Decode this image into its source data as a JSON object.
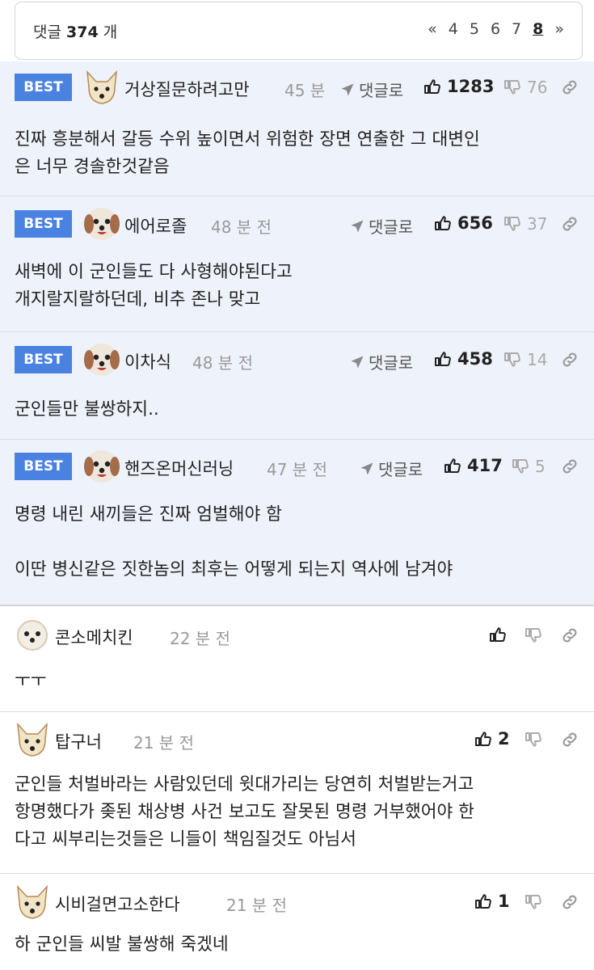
{
  "header": {
    "count_prefix": "댓글",
    "count": "374",
    "count_suffix": "개",
    "pager": [
      "«",
      "4",
      "5",
      "6",
      "7",
      "8",
      "»"
    ]
  },
  "reply_label": "댓글로",
  "best_badge": "BEST",
  "best_comments": [
    {
      "nick": "거상질문하려고만",
      "time": "45 분",
      "up": "1283",
      "down": "76",
      "lines": [
        "진짜 흥분해서 갈등 수위 높이면서 위험한 장면 연출한 그 대변인",
        "은 너무 경솔한것같음"
      ]
    },
    {
      "nick": "에어로졸",
      "time": "48 분 전",
      "up": "656",
      "down": "37",
      "lines": [
        "새벽에 이 군인들도 다 사형해야된다고",
        "개지랄지랄하던데, 비추 존나 맞고"
      ]
    },
    {
      "nick": "이차식",
      "time": "48 분 전",
      "up": "458",
      "down": "14",
      "lines": [
        "군인들만 불쌍하지.."
      ]
    },
    {
      "nick": "핸즈온머신러닝",
      "time": "47 분 전",
      "up": "417",
      "down": "5",
      "lines": [
        "명령 내린 새끼들은 진짜 엄벌해야 함",
        "",
        "이딴 병신같은 짓한놈의 최후는 어떻게 되는지 역사에 남겨야"
      ]
    }
  ],
  "comments": [
    {
      "nick": "콘소메치킨",
      "time": "22 분 전",
      "up": "",
      "lines": [
        "ㅜㅜ"
      ]
    },
    {
      "nick": "탑구너",
      "time": "21 분 전",
      "up": "2",
      "lines": [
        "군인들 처벌바라는 사람있던데 윗대가리는 당연히 처벌받는거고",
        "항명했다가 좆된 채상병 사건 보고도 잘못된 명령 거부했어야 한",
        "다고 씨부리는것들은 니들이 책임질것도 아님서"
      ]
    },
    {
      "nick": "시비걸면고소한다",
      "time": "21 분 전",
      "up": "1",
      "lines": [
        "하 군인들 씨발 불쌍해 죽겠네"
      ]
    }
  ]
}
